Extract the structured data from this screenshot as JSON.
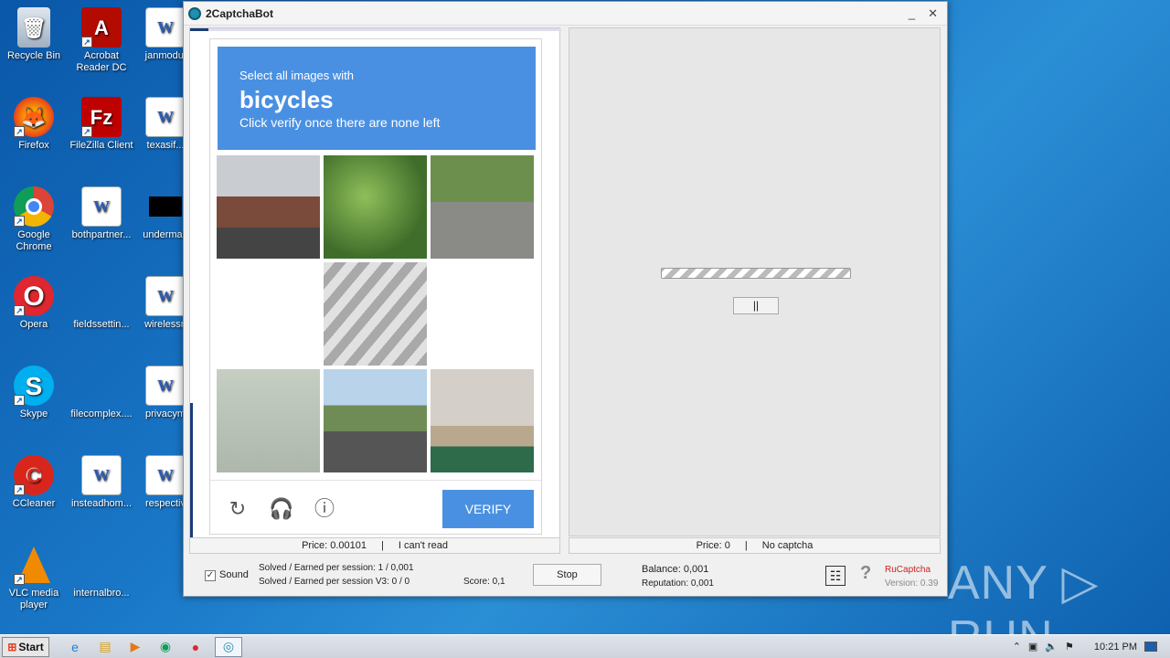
{
  "desktop": {
    "icons_col1": [
      "Recycle Bin",
      "Firefox",
      "Google Chrome",
      "Opera",
      "Skype",
      "CCleaner",
      "VLC media player"
    ],
    "icons_col2": [
      "Acrobat Reader DC",
      "FileZilla Client",
      "bothpartner...",
      "fieldssettin...",
      "filecomplex....",
      "insteadhom...",
      "internalbro..."
    ],
    "icons_col3": [
      "janmodul",
      "texasif...",
      "underman",
      "wirelessn",
      "privacym",
      "respectiv"
    ]
  },
  "window": {
    "title": "2CaptchaBot",
    "minimize": "_",
    "close": "✕"
  },
  "captcha": {
    "prompt_line1": "Select all images with",
    "prompt_target": "bicycles",
    "prompt_line3": "Click verify once there are none left",
    "verify_label": "VERIFY",
    "icons": [
      "refresh-icon",
      "headphones-icon",
      "info-icon"
    ]
  },
  "left_status": {
    "price": "Price: 0.00101",
    "separator": "|",
    "cant_read": "I can't read"
  },
  "right_panel": {
    "pause_label": "||"
  },
  "right_status": {
    "price": "Price: 0",
    "separator": "|",
    "no_captcha": "No captcha"
  },
  "footer": {
    "sound_checked": "✓",
    "sound_label": "Sound",
    "solved_line1": "Solved / Earned per session: 1 / 0,001",
    "solved_line2": "Solved / Earned per session V3: 0 / 0",
    "score": "Score: 0,1",
    "stop_label": "Stop",
    "balance": "Balance:  0,001",
    "reputation": "Reputation: 0,001",
    "brand": "RuCaptcha",
    "version": "Version: 0.39"
  },
  "watermark": "ANY ▷ RUN",
  "taskbar": {
    "start_label": "Start",
    "time": "10:21 PM"
  }
}
